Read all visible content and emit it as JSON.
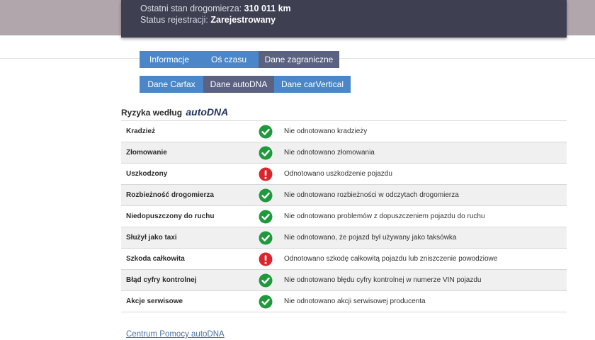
{
  "summary": {
    "odometer_label": "Ostatni stan drogomierza:",
    "odometer_value": "310 011 km",
    "registration_label": "Status rejestracji:",
    "registration_value": "Zarejestrowany"
  },
  "tabs_row1": [
    "Informacje",
    "Oś czasu",
    "Dane zagraniczne"
  ],
  "tabs_row2": [
    "Dane Carfax",
    "Dane autoDNA",
    "Dane carVertical"
  ],
  "section": {
    "title_prefix": "Ryzyka według",
    "title_brand": "autoDNA"
  },
  "colors": {
    "ok": "#1e9a3c",
    "alert": "#d9262c",
    "tab_blue": "#4b86c8",
    "tab_dark": "#5b6180"
  },
  "risks": [
    {
      "label": "Kradzież",
      "status": "ok",
      "icon": "check-circle-icon",
      "description": "Nie odnotowano kradzieży"
    },
    {
      "label": "Złomowanie",
      "status": "ok",
      "icon": "check-circle-icon",
      "description": "Nie odnotowano złomowania"
    },
    {
      "label": "Uszkodzony",
      "status": "alert",
      "icon": "exclamation-circle-icon",
      "description": "Odnotowano uszkodzenie pojazdu"
    },
    {
      "label": "Rozbieżność drogomierza",
      "status": "ok",
      "icon": "check-circle-icon",
      "description": "Nie odnotowano rozbieżności w odczytach drogomierza"
    },
    {
      "label": "Niedopuszczony do ruchu",
      "status": "ok",
      "icon": "check-circle-icon",
      "description": "Nie odnotowano problemów z dopuszczeniem pojazdu do ruchu"
    },
    {
      "label": "Służył jako taxi",
      "status": "ok",
      "icon": "check-circle-icon",
      "description": "Nie odnotowano, że pojazd był używany jako taksówka"
    },
    {
      "label": "Szkoda całkowita",
      "status": "alert",
      "icon": "exclamation-circle-icon",
      "description": "Odnotowano szkodę całkowitą pojazdu lub zniszczenie powodziowe"
    },
    {
      "label": "Błąd cyfry kontrolnej",
      "status": "ok",
      "icon": "check-circle-icon",
      "description": "Nie odnotowano błędu cyfry kontrolnej w numerze VIN pojazdu"
    },
    {
      "label": "Akcje serwisowe",
      "status": "ok",
      "icon": "check-circle-icon",
      "description": "Nie odnotowano akcji serwisowej producenta"
    }
  ],
  "footer": {
    "help_link": "Centrum Pomocy autoDNA"
  }
}
